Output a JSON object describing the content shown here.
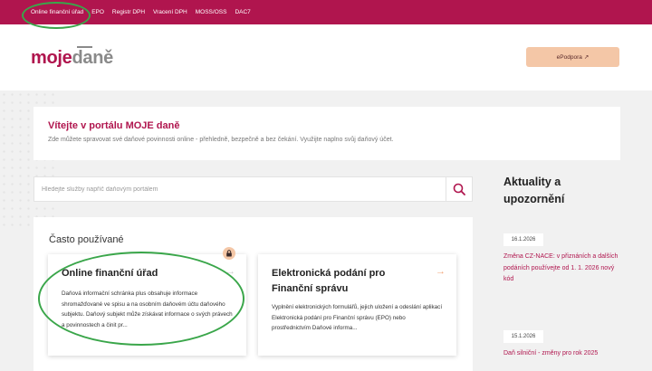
{
  "topnav": {
    "items": [
      "Online finanční úřad",
      "EPO",
      "Registr DPH",
      "Vracení DPH",
      "MOSS/OSS",
      "DAC7"
    ]
  },
  "header": {
    "logo_part1": "moje",
    "logo_part2": "daně",
    "support_button": "ePodpora",
    "support_arrow": "↗"
  },
  "welcome": {
    "title": "Vítejte v portálu MOJE daně",
    "subtitle": "Zde můžete spravovat své daňové povinnosti online - přehledně, bezpečně a bez čekání. Využijte naplno svůj daňový účet."
  },
  "search": {
    "placeholder": "Hledejte služby napříč daňovým portálem"
  },
  "frequent": {
    "heading": "Často používané",
    "tiles": [
      {
        "title": "Online finanční úřad",
        "description": "Daňová informační schránka plus obsahuje informace shromažďované ve spisu a na osobním daňovém účtu daňového subjektu. Daňový subjekt může získávat informace o svých právech a povinnostech a činit pr...",
        "arrow": "→"
      },
      {
        "title": "Elektronická podání pro Finanční správu",
        "description": "Vyplnění elektronických formulářů, jejich uložení a odeslání aplikací Elektronická podání pro Finanční správu (EPO) nebo prostřednictvím Daňové informa...",
        "arrow": "→"
      }
    ]
  },
  "news": {
    "title": "Aktuality a upozornění",
    "items": [
      {
        "date": "16.1.2026",
        "text": "Změna CZ-NACE: v přiznáních a dalších podáních používejte od 1. 1. 2026 nový kód"
      },
      {
        "date": "15.1.2026",
        "text": "Daň silniční - změny pro rok 2025"
      }
    ]
  },
  "colors": {
    "brand": "#b0154e",
    "accent": "#f4c7a7",
    "highlight_ring": "#3aa64a"
  },
  "icons": {
    "search": "search-icon",
    "lock": "lock-icon",
    "arrow": "arrow-right-icon"
  }
}
